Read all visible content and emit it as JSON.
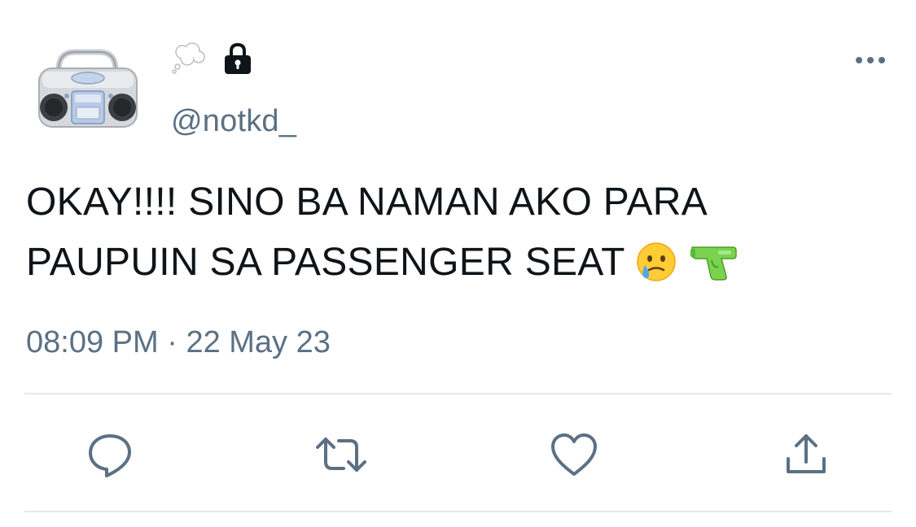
{
  "user": {
    "handle": "@notkd_"
  },
  "tweet": {
    "line1": "OKAY!!!! SINO BA NAMAN AKO PARA",
    "line2": "PAUPUIN SA PASSENGER SEAT",
    "emojis": [
      "face-holding-back-tears",
      "water-pistol"
    ],
    "time": "08:09 PM",
    "separator": " · ",
    "date": "22 May 23"
  },
  "actions": [
    "reply-icon",
    "retweet-icon",
    "like-icon",
    "share-icon"
  ],
  "colors": {
    "text": "#0f1419",
    "secondary": "#5b7083",
    "divider": "#e1e8ed",
    "background": "#ffffff"
  }
}
